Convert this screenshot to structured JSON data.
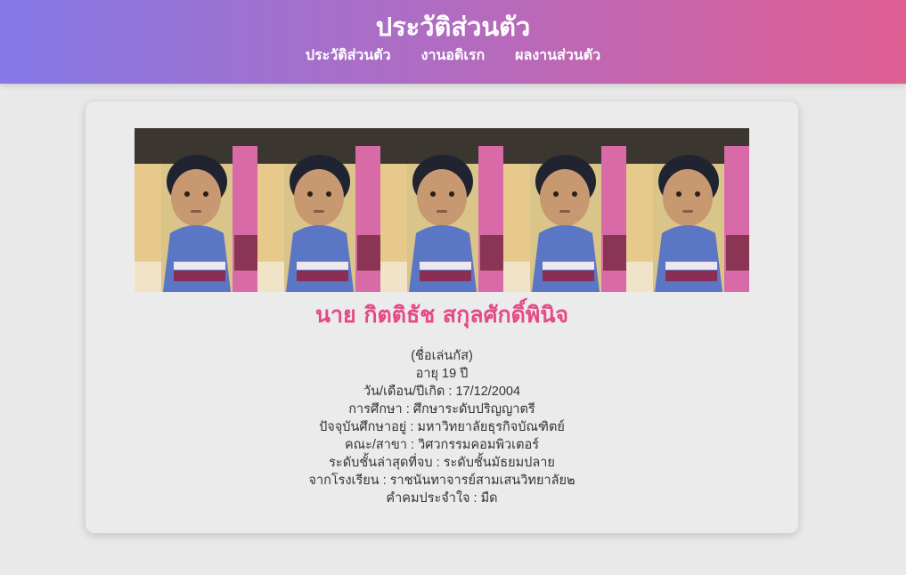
{
  "header": {
    "title": "ประวัติส่วนตัว",
    "nav": [
      {
        "label": "ประวัติส่วนตัว"
      },
      {
        "label": "งานอดิเรก"
      },
      {
        "label": "ผลงานส่วนตัว"
      }
    ]
  },
  "colors": {
    "header_gradient_start": "#8479e6",
    "header_gradient_end": "#e05e92",
    "name_color": "#e44a86",
    "background": "#e9e9e9"
  },
  "profile": {
    "name": "นาย กิตติธัช สกุลศักดิ์พินิจ",
    "details": [
      "(ชื่อเล่นกัส)",
      "อายุ 19 ปี",
      "วัน/เดือน/ปีเกิด : 17/12/2004",
      "การศึกษา : ศึกษาระดับปริญญาตรี",
      "ปัจจุบันศึกษาอยู่ : มหาวิทยาลัยธุรกิจบัณฑิตย์",
      "คณะ/สาขา : วิศวกรรมคอมพิวเตอร์",
      "ระดับชั้นล่าสุดที่จบ : ระดับชั้นมัธยมปลาย",
      "จากโรงเรียน : ราชนันทาจารย์สามเสนวิทยาลัย๒",
      "คำคมประจำใจ : มืด"
    ]
  }
}
